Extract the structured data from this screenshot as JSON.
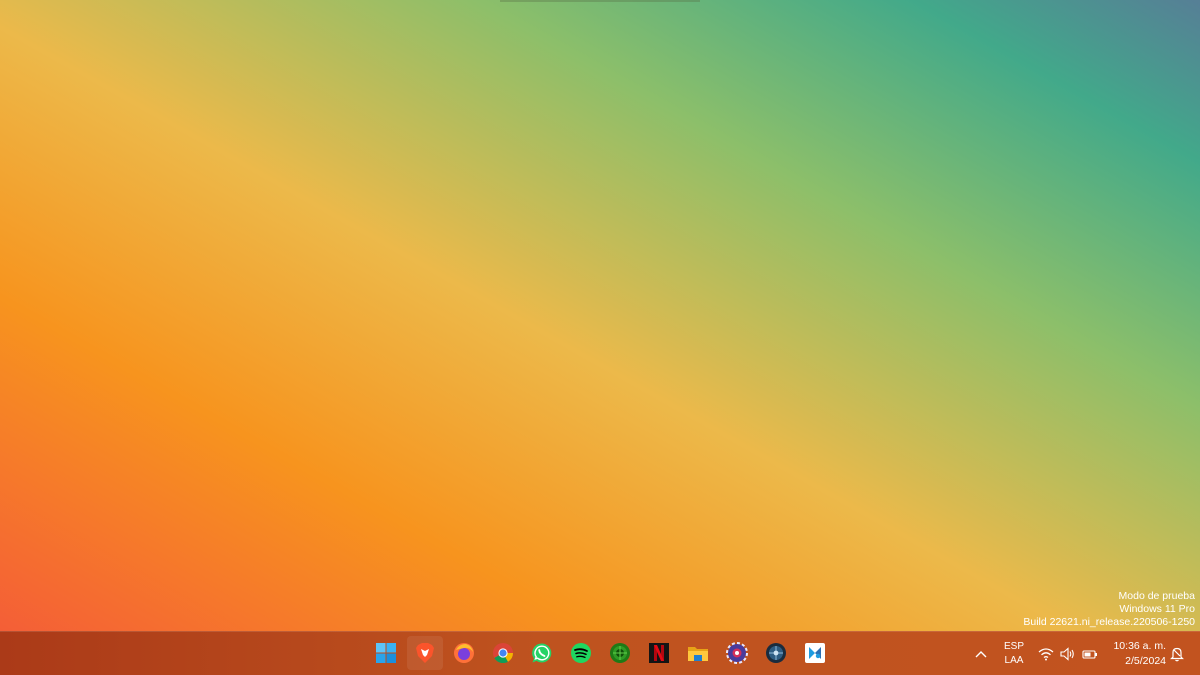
{
  "desktop": {
    "watermark": {
      "line1": "Modo de prueba",
      "line2": "Windows 11 Pro",
      "line3": "Build 22621.ni_release.220506-1250"
    }
  },
  "taskbar": {
    "apps": [
      {
        "icon": "windows-start-icon"
      },
      {
        "icon": "brave-browser-icon"
      },
      {
        "icon": "firefox-icon"
      },
      {
        "icon": "chrome-icon"
      },
      {
        "icon": "whatsapp-icon"
      },
      {
        "icon": "spotify-icon"
      },
      {
        "icon": "green-app-icon"
      },
      {
        "icon": "netflix-icon"
      },
      {
        "icon": "file-explorer-icon"
      },
      {
        "icon": "settings-gear-app-icon"
      },
      {
        "icon": "dark-globe-app-icon"
      },
      {
        "icon": "blue-app-icon"
      }
    ],
    "tray": {
      "lang_line1": "ESP",
      "lang_line2": "LAA",
      "time": "10:36 a. m.",
      "date": "2/5/2024"
    }
  },
  "colors": {
    "taskbar": "#b5441d",
    "accent_windows": "#3aa0e8"
  }
}
